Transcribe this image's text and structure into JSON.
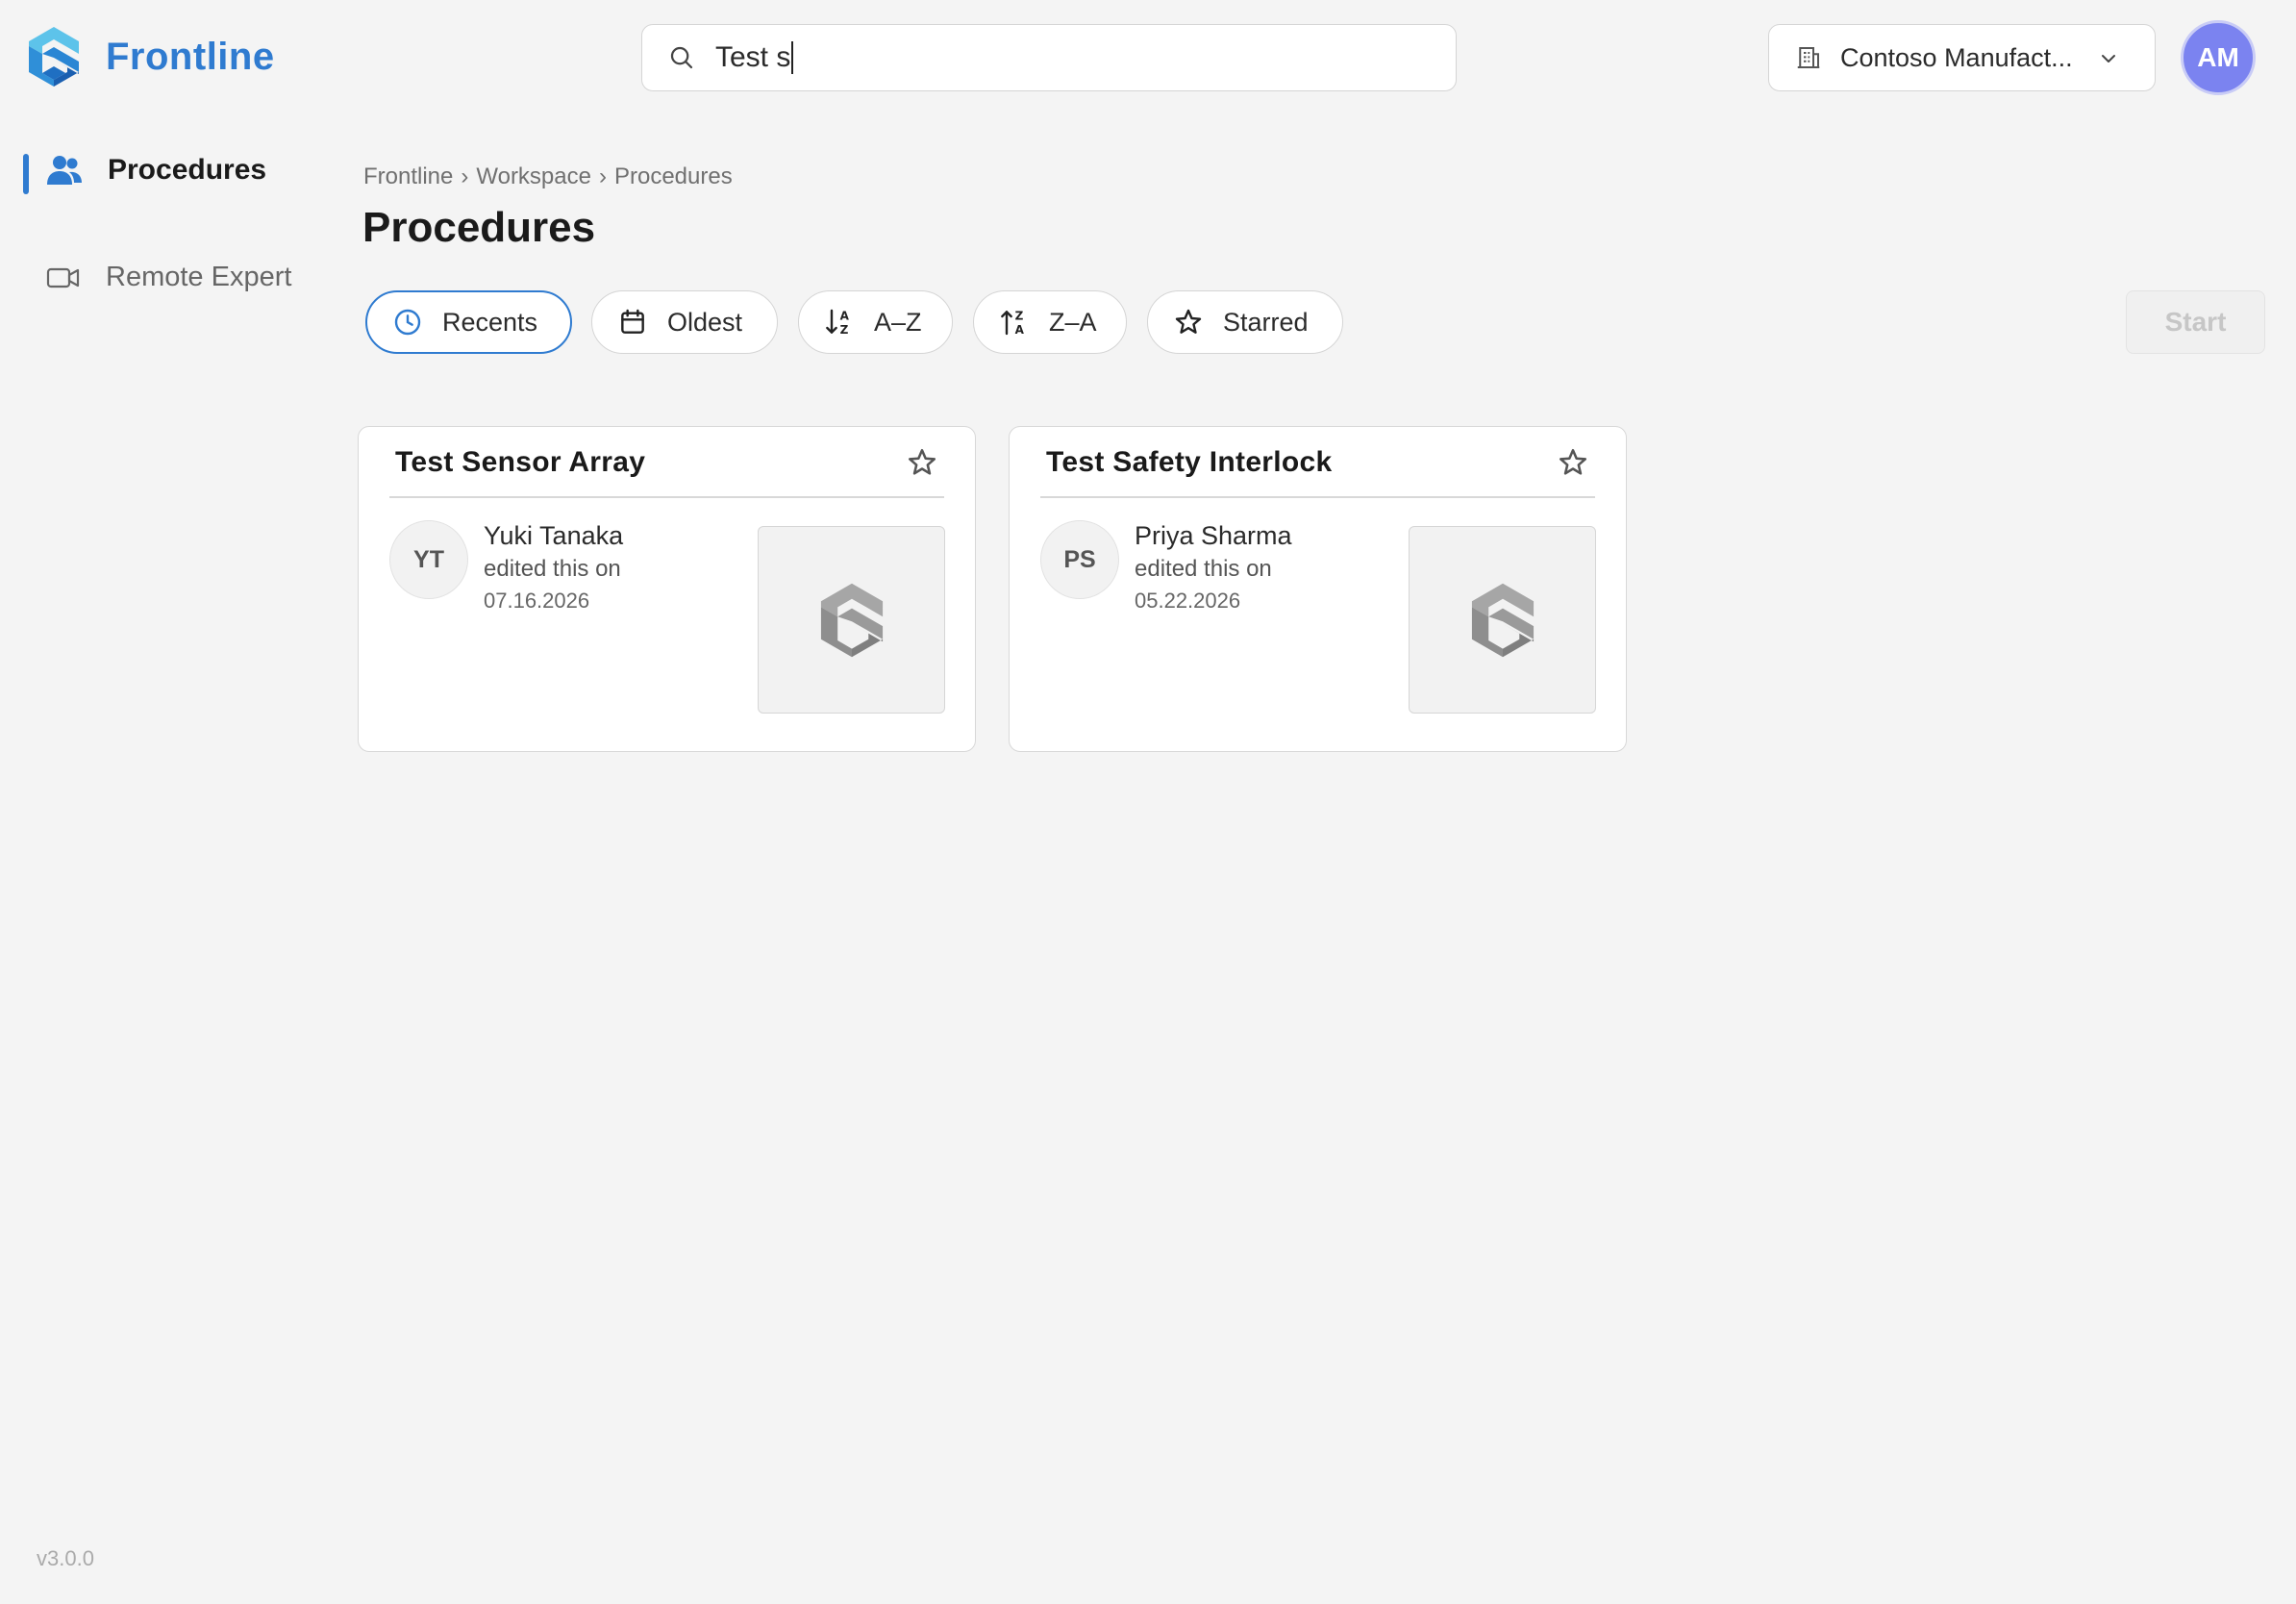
{
  "app": {
    "name": "Frontline"
  },
  "search": {
    "value": "Test s",
    "icon": "search-icon"
  },
  "org": {
    "label": "Contoso Manufact...",
    "icon": "building-icon"
  },
  "user": {
    "initials": "AM",
    "avatar_color": "#7b83f0"
  },
  "sidebar": {
    "items": [
      {
        "label": "Procedures",
        "icon": "people-icon",
        "active": true
      },
      {
        "label": "Remote Expert",
        "icon": "video-camera-icon",
        "active": false
      }
    ]
  },
  "breadcrumb": {
    "items": [
      "Frontline",
      "Workspace",
      "Procedures"
    ],
    "separator": "›"
  },
  "page": {
    "title": "Procedures"
  },
  "filters": [
    {
      "label": "Recents",
      "icon": "clock-icon",
      "active": true
    },
    {
      "label": "Oldest",
      "icon": "calendar-icon",
      "active": false
    },
    {
      "label": "A–Z",
      "icon": "sort-ascending-icon",
      "active": false
    },
    {
      "label": "Z–A",
      "icon": "sort-descending-icon",
      "active": false
    },
    {
      "label": "Starred",
      "icon": "star-icon",
      "active": false
    }
  ],
  "actions": {
    "start_label": "Start",
    "start_enabled": false
  },
  "cards": [
    {
      "title": "Test Sensor Array",
      "initials": "YT",
      "author": "Yuki Tanaka",
      "edited_text": "edited this on",
      "date": "07.16.2026"
    },
    {
      "title": "Test Safety Interlock",
      "initials": "PS",
      "author": "Priya Sharma",
      "edited_text": "edited this on",
      "date": "05.22.2026"
    }
  ],
  "footer": {
    "version": "v3.0.0"
  },
  "colors": {
    "accent": "#2f7bd0",
    "background": "#f4f4f4"
  }
}
